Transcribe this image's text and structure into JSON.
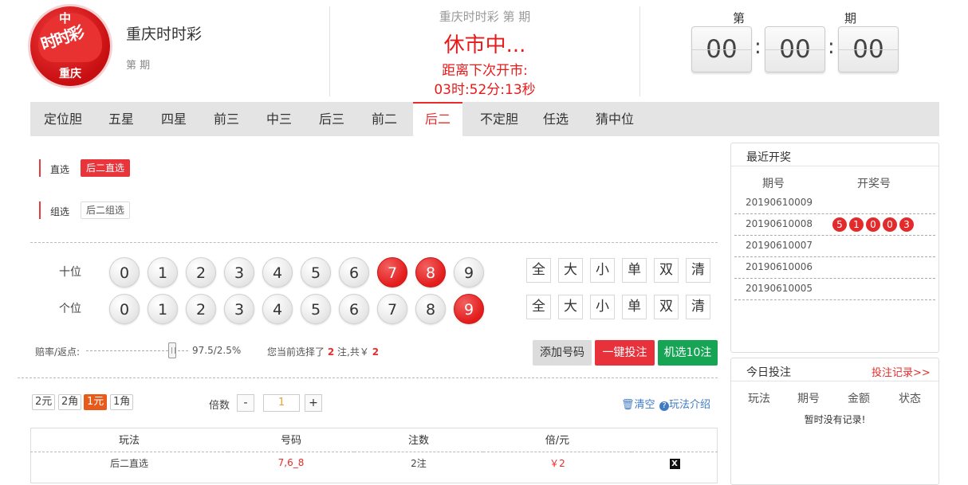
{
  "header": {
    "logo": {
      "mark": "中",
      "art": "时时彩",
      "city": "重庆"
    },
    "lottery_title": "重庆时时彩",
    "issue_label": "第 期",
    "mid_issue": "重庆时时彩 第 期",
    "status": "休市中...",
    "next_open_label": "距离下次开市:",
    "next_open_countdown": "03时:52分:13秒",
    "countdown": {
      "label_left": "第",
      "label_right": "期",
      "hours": "00",
      "minutes": "00",
      "seconds": "00",
      "sep": ":"
    }
  },
  "tabs": [
    "定位胆",
    "五星",
    "四星",
    "前三",
    "中三",
    "后三",
    "前二",
    "后二",
    "不定胆",
    "任选",
    "猜中位"
  ],
  "active_tab": "后二",
  "play_types": {
    "direct": {
      "label": "直选",
      "option": "后二直选"
    },
    "group": {
      "label": "组选",
      "option": "后二组选"
    }
  },
  "number_rows": [
    {
      "label": "十位",
      "numbers": [
        "0",
        "1",
        "2",
        "3",
        "4",
        "5",
        "6",
        "7",
        "8",
        "9"
      ],
      "selected": [
        "7",
        "8"
      ]
    },
    {
      "label": "个位",
      "numbers": [
        "0",
        "1",
        "2",
        "3",
        "4",
        "5",
        "6",
        "7",
        "8",
        "9"
      ],
      "selected": [
        "9"
      ]
    }
  ],
  "quick_buttons": [
    "全",
    "大",
    "小",
    "单",
    "双",
    "清"
  ],
  "odds": {
    "label": "赔率/返点:",
    "value": "97.5/2.5%",
    "slider_fraction": 0.87
  },
  "selection_summary": {
    "prefix": "您当前选择了",
    "count": "2",
    "mid": "注,共￥",
    "amount": "2"
  },
  "actions": {
    "add": "添加号码",
    "one_click_bet": "一键投注",
    "random10": "机选10注"
  },
  "units": [
    "2元",
    "2角",
    "1元",
    "1角"
  ],
  "active_unit": "1元",
  "multiplier": {
    "label": "倍数",
    "minus": "-",
    "value": "1",
    "plus": "+"
  },
  "links": {
    "clear": "清空",
    "rules": "玩法介绍"
  },
  "order_table": {
    "headers": [
      "玩法",
      "号码",
      "注数",
      "倍/元",
      ""
    ],
    "rows": [
      {
        "play": "后二直选",
        "numbers": "7,6_8",
        "bets": "2注",
        "amount": "￥2",
        "delete": "X"
      }
    ]
  },
  "recent_draws": {
    "title": "最近开奖",
    "headers": [
      "期号",
      "开奖号"
    ],
    "rows": [
      {
        "issue": "20190610009",
        "numbers": []
      },
      {
        "issue": "20190610008",
        "numbers": [
          "5",
          "1",
          "0",
          "0",
          "3"
        ]
      },
      {
        "issue": "20190610007",
        "numbers": []
      },
      {
        "issue": "20190610006",
        "numbers": []
      },
      {
        "issue": "20190610005",
        "numbers": []
      }
    ]
  },
  "today_bets": {
    "title": "今日投注",
    "record_link": "投注记录>>",
    "headers": [
      "玩法",
      "期号",
      "金额",
      "状态"
    ],
    "empty": "暂时没有记录!"
  },
  "colors": {
    "accent_red": "#e8323b",
    "green": "#17a555",
    "orange": "#e85a1a",
    "link_blue": "#3f7bc4"
  }
}
